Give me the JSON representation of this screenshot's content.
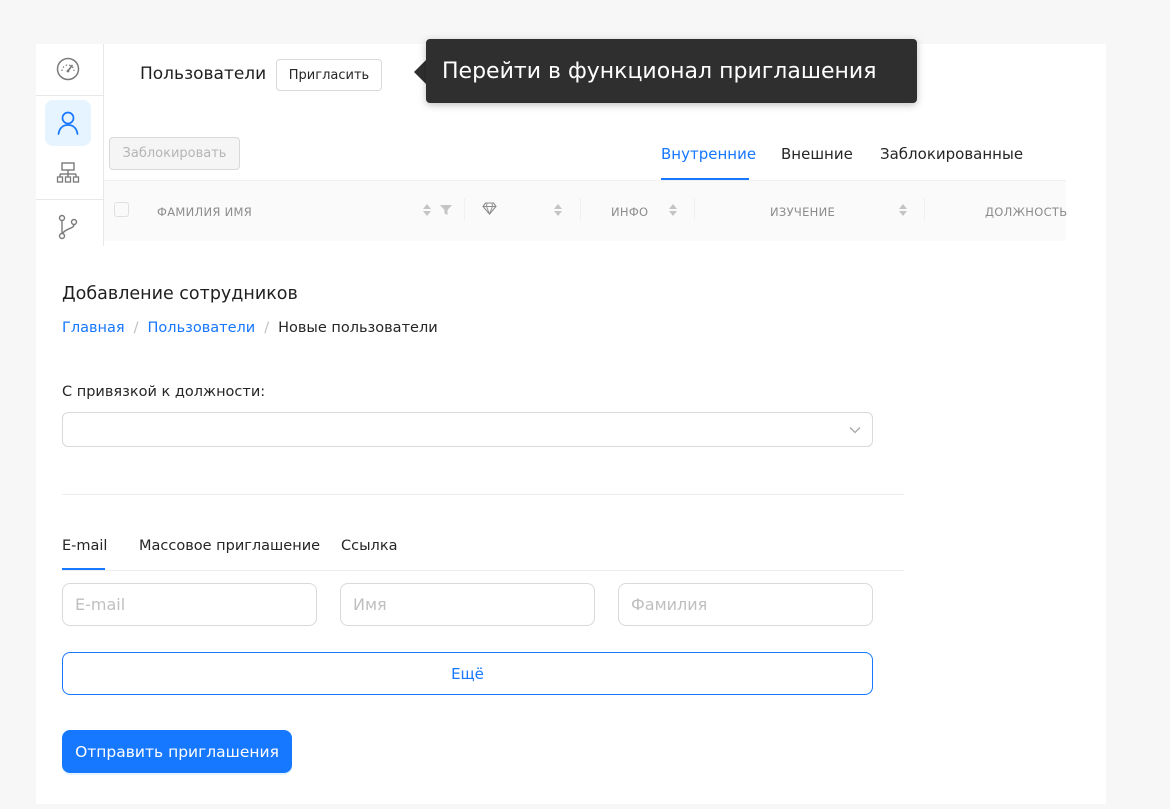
{
  "header": {
    "title": "Пользователи",
    "invite_button": "Пригласить",
    "tooltip": "Перейти в функционал приглашения"
  },
  "sidebar": {
    "items": [
      {
        "icon": "dashboard-icon"
      },
      {
        "icon": "user-icon",
        "active": true
      },
      {
        "icon": "org-structure-icon"
      },
      {
        "icon": "branch-icon"
      }
    ]
  },
  "toolbar": {
    "block_button": "Заблокировать"
  },
  "user_tabs": [
    {
      "label": "Внутренние",
      "active": true
    },
    {
      "label": "Внешние"
    },
    {
      "label": "Заблокированные"
    }
  ],
  "table": {
    "columns": [
      "ФАМИЛИЯ ИМЯ",
      "ИНФО",
      "ИЗУЧЕНИЕ",
      "ДОЛЖНОСТЬ"
    ]
  },
  "form": {
    "title": "Добавление сотрудников",
    "breadcrumb": [
      "Главная",
      "Пользователи",
      "Новые пользователи"
    ],
    "position_label": "С привязкой к должности:",
    "position_value": "",
    "tabs": [
      {
        "label": "E-mail",
        "active": true
      },
      {
        "label": "Массовое приглашение"
      },
      {
        "label": "Ссылка"
      }
    ],
    "email_placeholder": "E-mail",
    "name_placeholder": "Имя",
    "surname_placeholder": "Фамилия",
    "more_button": "Ещё",
    "send_button": "Отправить приглашения"
  },
  "colors": {
    "accent": "#1677ff",
    "tooltip_bg": "#2f2f2f"
  }
}
